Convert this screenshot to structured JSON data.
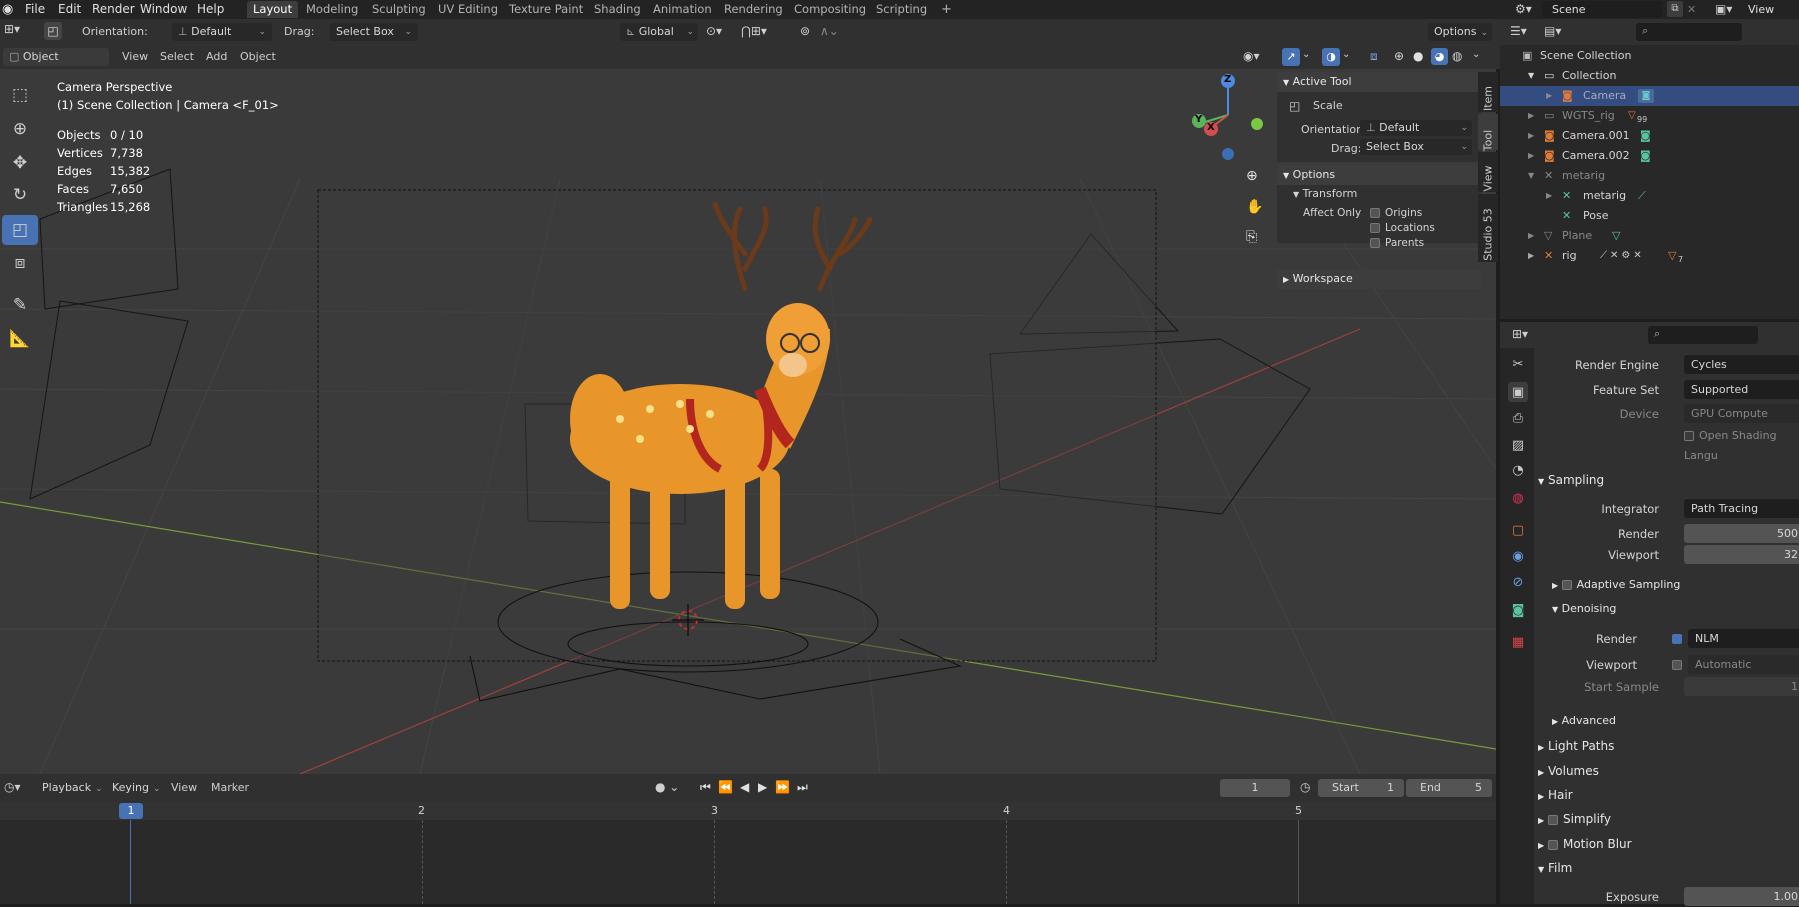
{
  "app": {
    "logo": "blender-icon"
  },
  "menu": [
    "File",
    "Edit",
    "Render",
    "Window",
    "Help"
  ],
  "workspaces": [
    "Layout",
    "Modeling",
    "Sculpting",
    "UV Editing",
    "Texture Paint",
    "Shading",
    "Animation",
    "Rendering",
    "Compositing",
    "Scripting"
  ],
  "active_workspace": "Layout",
  "scene": {
    "label": "Scene",
    "view_layer": "View Laye"
  },
  "tool_header": {
    "orientation_label": "Orientation:",
    "orientation_value": "Default",
    "drag_label": "Drag:",
    "drag_value": "Select Box",
    "transform_space": "Global",
    "options": "Options"
  },
  "viewport_header": {
    "mode": "Object Mode",
    "menus": [
      "View",
      "Select",
      "Add",
      "Object"
    ]
  },
  "viewport_info": {
    "title": "Camera Perspective",
    "subtitle": "(1) Scene Collection | Camera <F_01>",
    "stats": [
      {
        "k": "Objects",
        "v": "0 / 10"
      },
      {
        "k": "Vertices",
        "v": "7,738"
      },
      {
        "k": "Edges",
        "v": "15,382"
      },
      {
        "k": "Faces",
        "v": "7,650"
      },
      {
        "k": "Triangles",
        "v": "15,268"
      }
    ]
  },
  "gizmo": {
    "x": "X",
    "y": "Y",
    "z": "Z"
  },
  "npanel": {
    "tabs": [
      "Item",
      "Tool",
      "View",
      "Studio 53"
    ],
    "active_tool": "Active Tool",
    "tool_name": "Scale",
    "orientation_label": "Orientation",
    "orientation_value": "Default",
    "drag_label": "Drag:",
    "drag_value": "Select Box",
    "options": "Options",
    "transform": "Transform",
    "affect_only": "Affect Only",
    "checks": [
      "Origins",
      "Locations",
      "Parents"
    ],
    "workspace": "Workspace"
  },
  "outliner": {
    "root": "Scene Collection",
    "rows": [
      {
        "name": "Collection"
      },
      {
        "name": "Camera"
      },
      {
        "name": "WGTS_rig",
        "badge": "99"
      },
      {
        "name": "Camera.001"
      },
      {
        "name": "Camera.002"
      },
      {
        "name": "metarig"
      },
      {
        "name": "metarig"
      },
      {
        "name": "Pose"
      },
      {
        "name": "Plane"
      },
      {
        "name": "rig",
        "badge": "7"
      }
    ]
  },
  "properties": {
    "render_engine_label": "Render Engine",
    "render_engine": "Cycles",
    "feature_set_label": "Feature Set",
    "feature_set": "Supported",
    "device_label": "Device",
    "device": "GPU Compute",
    "osl": "Open Shading Langu",
    "sampling": "Sampling",
    "integrator_label": "Integrator",
    "integrator": "Path Tracing",
    "render_label": "Render",
    "render_samples": "500",
    "viewport_label": "Viewport",
    "viewport_samples": "32",
    "adaptive": "Adaptive Sampling",
    "denoising": "Denoising",
    "den_render_label": "Render",
    "den_render": "NLM",
    "den_viewport_label": "Viewport",
    "den_viewport": "Automatic",
    "start_sample_label": "Start Sample",
    "start_sample": "1",
    "advanced": "Advanced",
    "light_paths": "Light Paths",
    "volumes": "Volumes",
    "hair": "Hair",
    "simplify": "Simplify",
    "motion_blur": "Motion Blur",
    "film": "Film",
    "exposure_label": "Exposure",
    "exposure": "1.00"
  },
  "timeline": {
    "menus": [
      "Playback",
      "Keying",
      "View",
      "Marker"
    ],
    "current_frame": "1",
    "start_label": "Start",
    "start": "1",
    "end_label": "End",
    "end": "5",
    "ticks": [
      "1",
      "2",
      "3",
      "4",
      "5"
    ]
  }
}
